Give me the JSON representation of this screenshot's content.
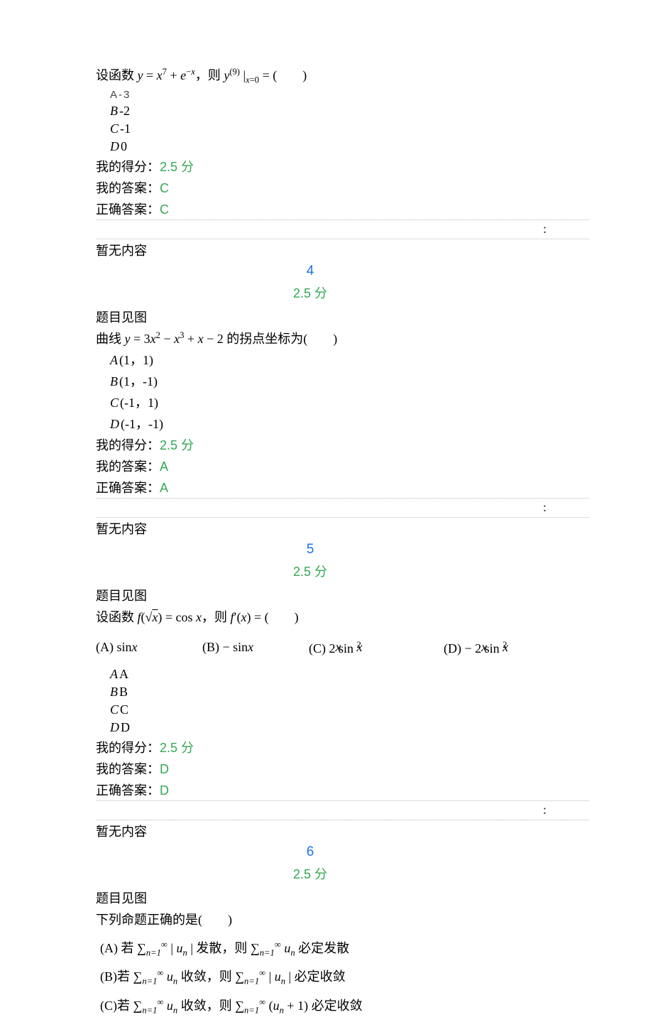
{
  "q3": {
    "stem": "设函数 y = x⁷ + e⁻ˣ，则 y⁽⁹⁾ |ₓ₌₀ = (　　)",
    "options": [
      {
        "letter": "A",
        "text": "-3"
      },
      {
        "letter": "B",
        "text": "-2"
      },
      {
        "letter": "C",
        "text": "-1"
      },
      {
        "letter": "D",
        "text": "0"
      }
    ],
    "my_score_label": "我的得分：",
    "my_score_value": "2.5 分",
    "my_answer_label": "我的答案：",
    "my_answer_value": "C",
    "correct_label": "正确答案：",
    "correct_value": "C",
    "analysis_placeholder": "暂无内容"
  },
  "q4": {
    "number": "4",
    "points": "2.5 分",
    "see_img": "题目见图",
    "stem": "曲线 y = 3x² − x³ + x − 2 的拐点坐标为(　　)",
    "options": [
      {
        "letter": "A",
        "text": "(1，1)"
      },
      {
        "letter": "B",
        "text": "(1，-1)"
      },
      {
        "letter": "C",
        "text": "(-1，1)"
      },
      {
        "letter": "D",
        "text": "(-1，-1)"
      }
    ],
    "my_score_label": "我的得分：",
    "my_score_value": "2.5 分",
    "my_answer_label": "我的答案：",
    "my_answer_value": "A",
    "correct_label": "正确答案：",
    "correct_value": "A",
    "analysis_placeholder": "暂无内容"
  },
  "q5": {
    "number": "5",
    "points": "2.5 分",
    "see_img": "题目见图",
    "stem": "设函数 f(√x) = cos x，则 f′(x) = (　　)",
    "math_options": [
      {
        "label": "(A) sin x"
      },
      {
        "label": "(B) − sin x"
      },
      {
        "label": "(C) 2x sin x²"
      },
      {
        "label": "(D) − 2x sin x²"
      }
    ],
    "options": [
      {
        "letter": "A",
        "text": "A"
      },
      {
        "letter": "B",
        "text": "B"
      },
      {
        "letter": "C",
        "text": "C"
      },
      {
        "letter": "D",
        "text": "D"
      }
    ],
    "my_score_label": "我的得分：",
    "my_score_value": "2.5 分",
    "my_answer_label": "我的答案：",
    "my_answer_value": "D",
    "correct_label": "正确答案：",
    "correct_value": "D",
    "analysis_placeholder": "暂无内容"
  },
  "q6": {
    "number": "6",
    "points": "2.5 分",
    "see_img": "题目见图",
    "stem": "下列命题正确的是(　　)",
    "math_options": [
      {
        "label": "(A) 若 ∑ₙ₌₁^∞ | uₙ | 发散，则 ∑ₙ₌₁^∞ uₙ 必定发散"
      },
      {
        "label": "(B) 若 ∑ₙ₌₁^∞ uₙ 收敛，则 ∑ₙ₌₁^∞ | uₙ | 必定收敛"
      },
      {
        "label": "(C) 若 ∑ₙ₌₁^∞ uₙ 收敛，则 ∑ₙ₌₁^∞ (uₙ + 1) 必定收敛"
      }
    ]
  }
}
